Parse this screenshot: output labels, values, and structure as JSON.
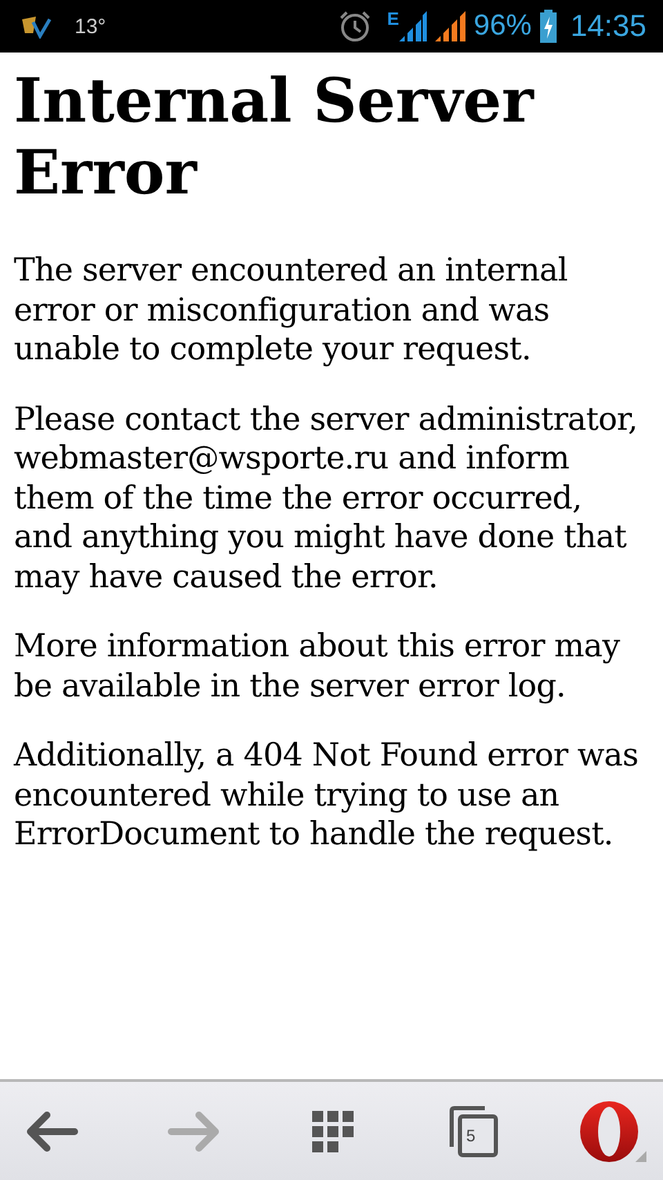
{
  "status_bar": {
    "temperature": "13°",
    "battery": "96%",
    "time": "14:35",
    "network_type": "E"
  },
  "page": {
    "title": "Internal Server Error",
    "paragraphs": [
      "The server encountered an internal error or misconfiguration and was unable to complete your request.",
      "Please contact the server administrator, webmaster@wsporte.ru and inform them of the time the error occurred, and anything you might have done that may have caused the error.",
      "More information about this error may be available in the server error log.",
      "Additionally, a 404 Not Found error was encountered while trying to use an ErrorDocument to handle the request."
    ]
  },
  "toolbar": {
    "back": {
      "disabled": false
    },
    "forward": {
      "disabled": true
    },
    "tab_count": "5"
  }
}
